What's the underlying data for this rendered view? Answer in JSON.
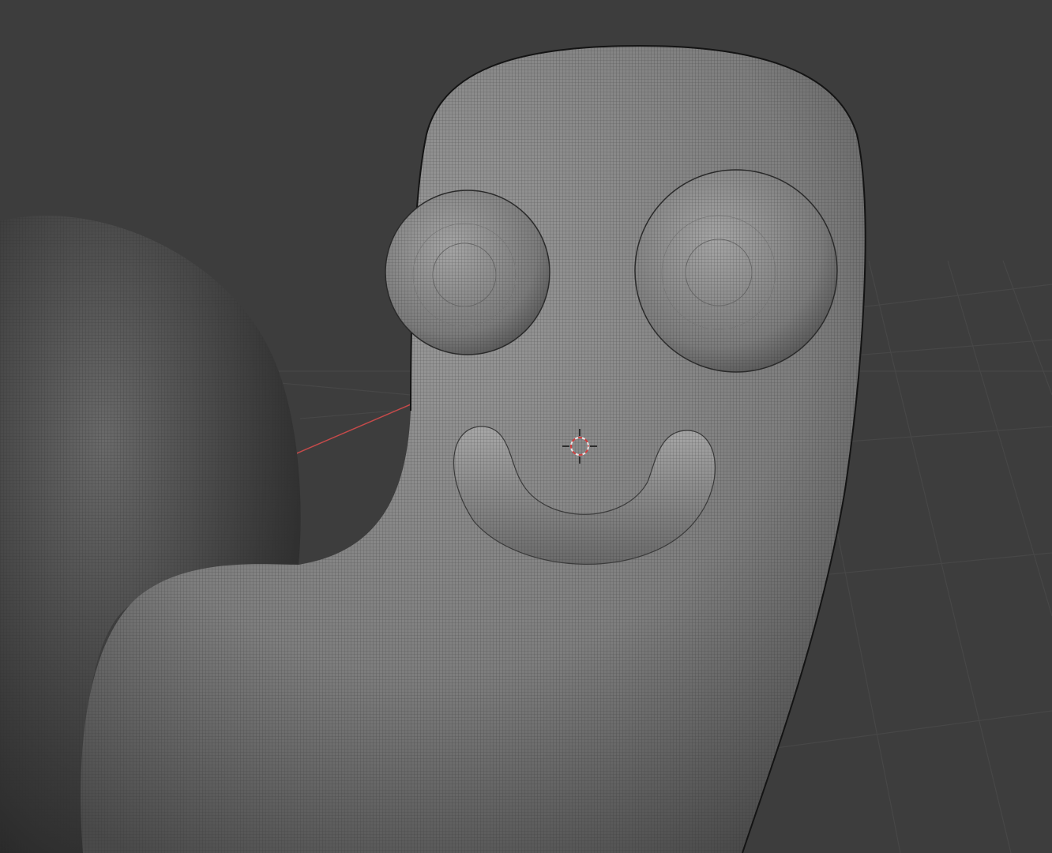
{
  "viewport": {
    "mode": "3d-viewport",
    "shading": "solid-wireframe-overlay",
    "background_color": "#3d3d3d",
    "grid_color": "#4a4a4a",
    "x_axis_color": "#c44a4a",
    "mesh_color": "#8a8a8a",
    "icons": [
      "3d-cursor-icon"
    ]
  }
}
